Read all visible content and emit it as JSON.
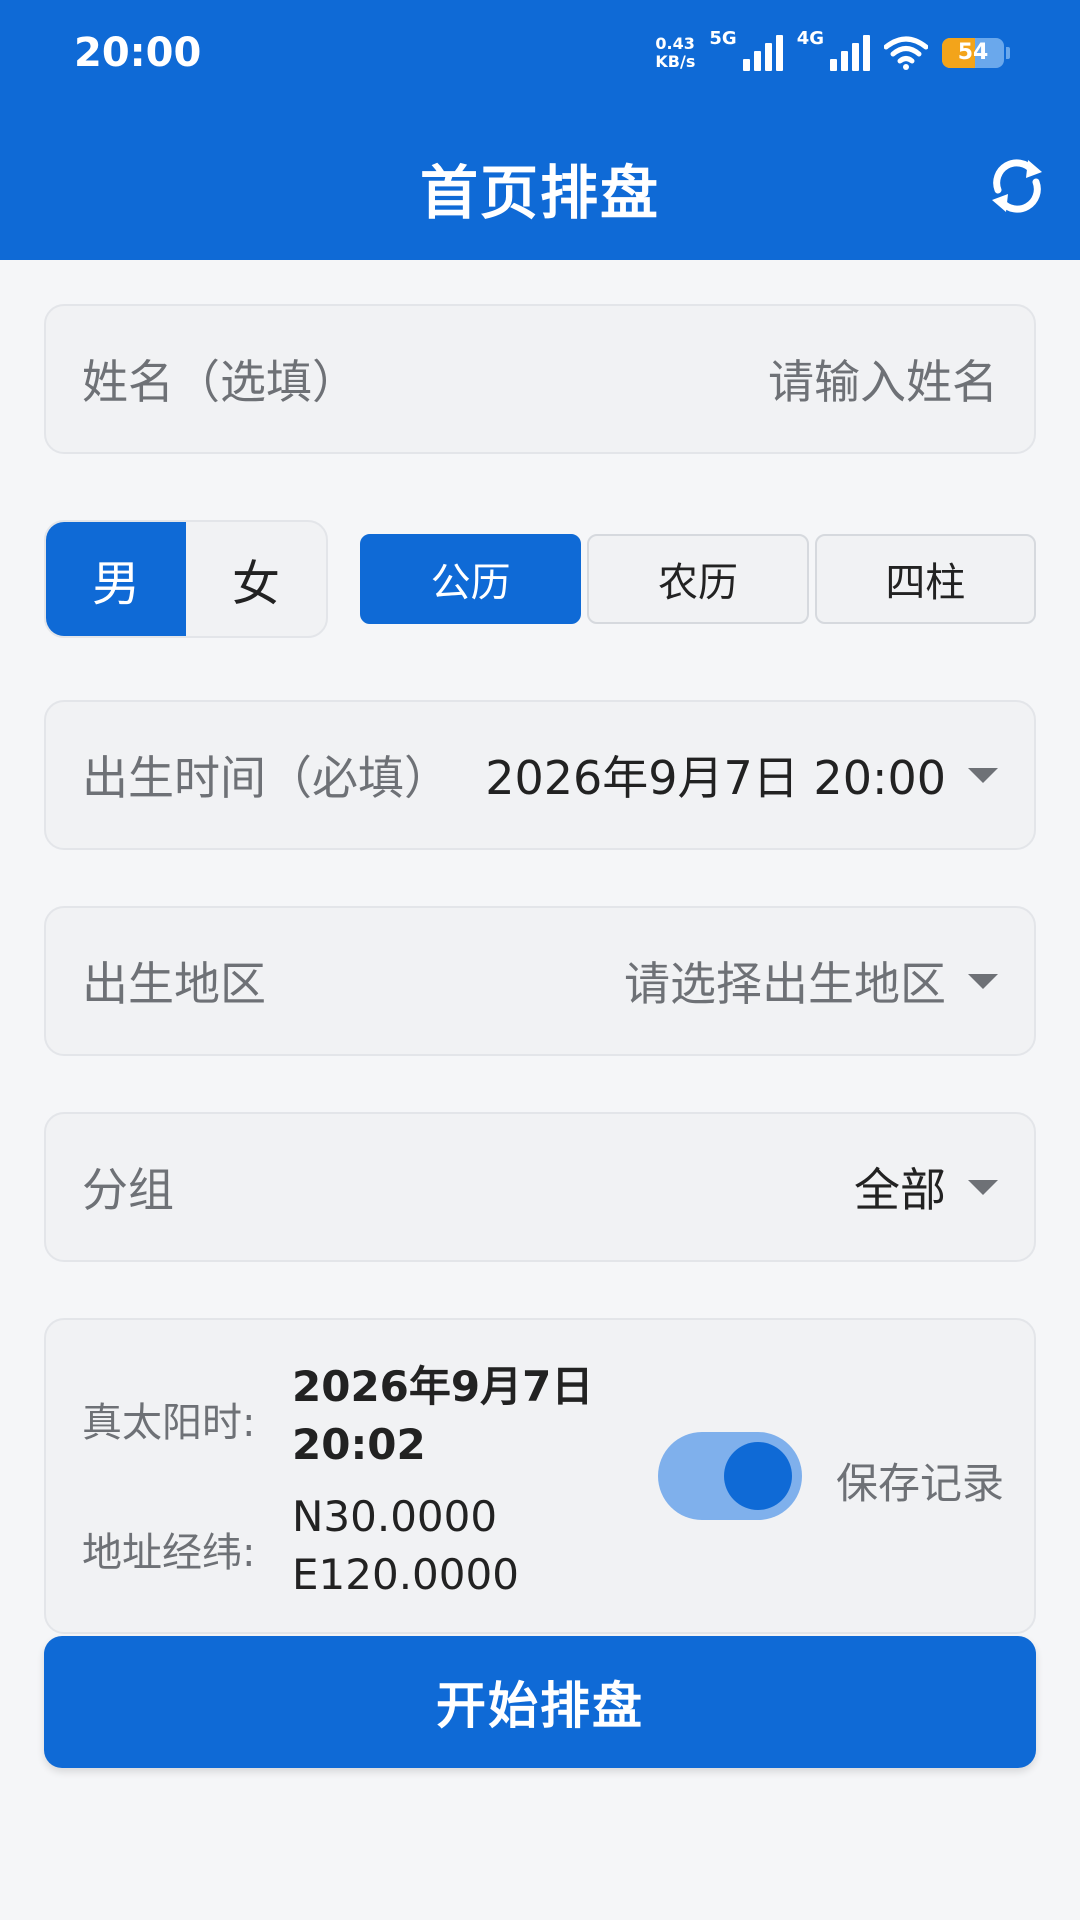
{
  "status_bar": {
    "time": "20:00",
    "speed_value": "0.43",
    "speed_unit": "KB/s",
    "network_1": "5G",
    "network_2": "4G",
    "battery": "54"
  },
  "app_bar": {
    "title": "首页排盘",
    "refresh_icon": "refresh-icon"
  },
  "form": {
    "name": {
      "label": "姓名（选填）",
      "placeholder": "请输入姓名"
    },
    "gender": {
      "male": "男",
      "female": "女",
      "selected": "男"
    },
    "calendar": {
      "options": [
        "公历",
        "农历",
        "四柱"
      ],
      "selected": "公历"
    },
    "birth_time": {
      "label": "出生时间（必填）",
      "value": "2026年9月7日 20:00"
    },
    "birth_region": {
      "label": "出生地区",
      "placeholder": "请选择出生地区"
    },
    "group": {
      "label": "分组",
      "value": "全部"
    }
  },
  "info": {
    "solar_time_label": "真太阳时:",
    "solar_time_date": "2026年9月7日",
    "solar_time_clock": "20:02",
    "coords_label": "地址经纬:",
    "latitude": "N30.0000",
    "longitude": "E120.0000",
    "save_record_label": "保存记录",
    "save_record_enabled": true
  },
  "start_button": "开始排盘",
  "colors": {
    "primary": "#0f6ad6",
    "toggle_track": "#7fb0ec",
    "battery": "#f3a41a"
  }
}
